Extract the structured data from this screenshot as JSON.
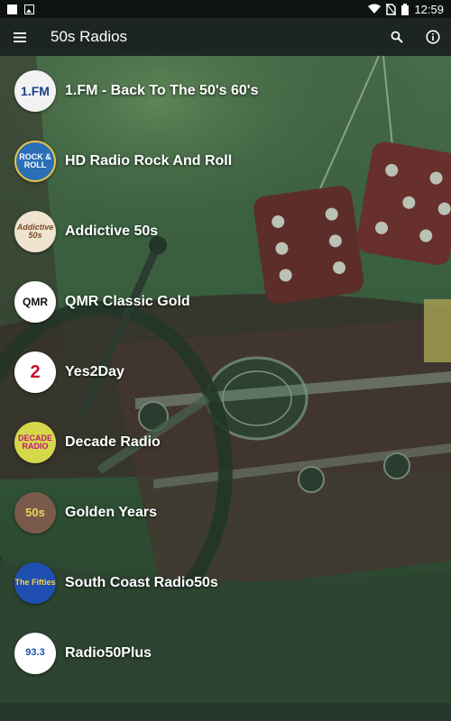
{
  "status_bar": {
    "time": "12:59"
  },
  "app_bar": {
    "title": "50s Radios",
    "menu_icon": "hamburger-menu-icon",
    "search_icon": "search-icon",
    "info_icon": "info-icon"
  },
  "colors": {
    "status_bar_bg": "#0e1210",
    "app_bar_bg": "#1c2520",
    "dice_red": "#6b1e24",
    "overlay_green": "#2f5a38"
  },
  "stations": [
    {
      "name": "1.FM - Back To The 50's 60's",
      "logo_text": "1.FM"
    },
    {
      "name": "HD Radio Rock And Roll",
      "logo_text": "ROCK & ROLL"
    },
    {
      "name": "Addictive 50s",
      "logo_text": "Addictive 50s"
    },
    {
      "name": "QMR Classic Gold",
      "logo_text": "QMR"
    },
    {
      "name": "Yes2Day",
      "logo_text": "2"
    },
    {
      "name": "Decade Radio",
      "logo_text": "DECADE RADIO"
    },
    {
      "name": "Golden Years",
      "logo_text": "50s"
    },
    {
      "name": "South Coast Radio50s",
      "logo_text": "The Fifties"
    },
    {
      "name": "Radio50Plus",
      "logo_text": "93.3"
    }
  ]
}
